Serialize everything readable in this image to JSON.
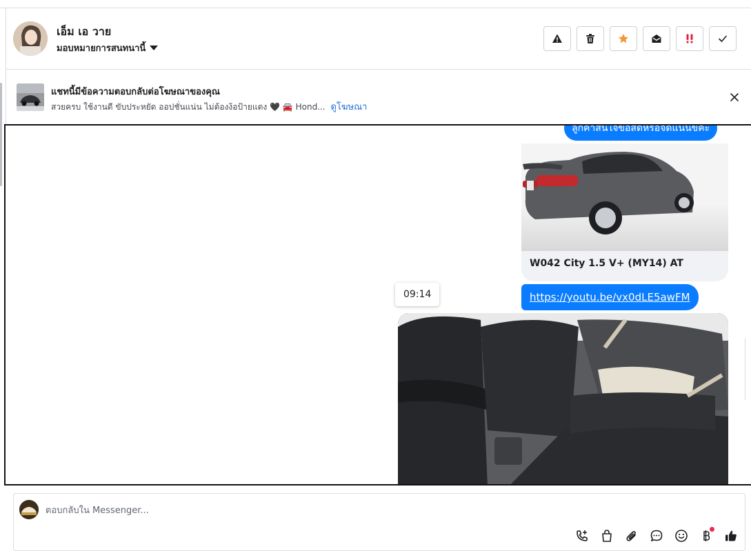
{
  "header": {
    "contact_name": "เอ็ม เอ วาย",
    "assign_label": "มอบหมายการสนทนานี้",
    "actions": [
      {
        "name": "report-spam-button",
        "icon": "warning-icon"
      },
      {
        "name": "delete-button",
        "icon": "trash-icon"
      },
      {
        "name": "star-button",
        "icon": "star-icon"
      },
      {
        "name": "mark-unread-button",
        "icon": "envelope-open-icon"
      },
      {
        "name": "follow-up-button",
        "icon": "double-exclamation-icon"
      },
      {
        "name": "mark-done-button",
        "icon": "check-icon"
      }
    ],
    "colors": {
      "star": "#f5943a",
      "followup": "#e41e3f"
    }
  },
  "ad_banner": {
    "title": "แชทนี้มีข้อความตอบกลับต่อโฆษณาของคุณ",
    "description": "สวยครบ ใช้งานดี ขับประหยัด ออปชั่นแน่น ไม่ต้องง้อป้ายแดง 🖤 🚘 Hond...",
    "link": "ดูโฆษณา"
  },
  "messages": {
    "top_bubble": "ลูกค้าสนใจข้อสดหรือจัดแนนขคะ",
    "product_card_title": "W042 City 1.5 V+ (MY14) AT",
    "timestamp": "09:14",
    "link": "https://youtu.be/vx0dLE5awFM"
  },
  "composer": {
    "placeholder": "ตอบกลับใน Messenger...",
    "tools": [
      "call-add-icon",
      "shopping-bag-icon",
      "paperclip-icon",
      "chat-bubble-icon",
      "emoji-icon",
      "baht-icon",
      "thumbs-up-icon"
    ]
  },
  "colors": {
    "accent": "#0a7cff",
    "link": "#216fdb",
    "border": "#dadde1"
  }
}
